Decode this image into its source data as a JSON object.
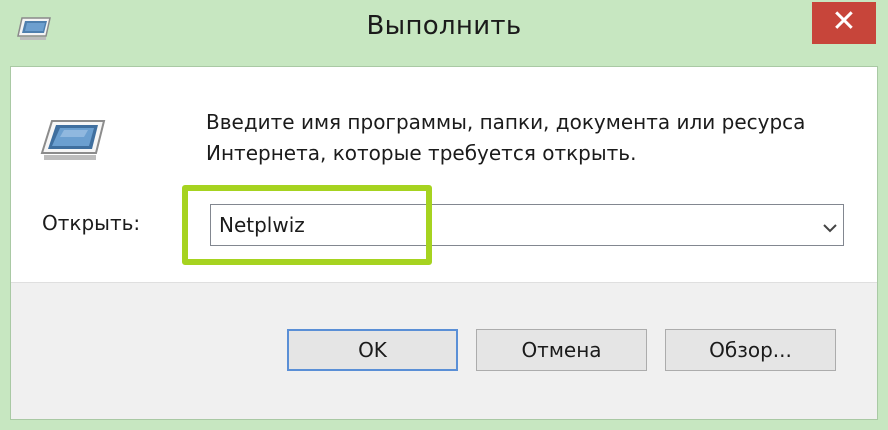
{
  "window": {
    "title": "Выполнить",
    "close_label": "✕",
    "accent_color": "#c7e7c1",
    "close_color": "#c7453a"
  },
  "dialog": {
    "description_line1": "Введите имя программы, папки, документа или ресурса",
    "description_line2": "Интернета, которые требуется открыть.",
    "open_label": "Открыть:",
    "open_value": "Netplwiz",
    "highlight_color": "#a6d320"
  },
  "buttons": {
    "ok": "OK",
    "cancel": "Отмена",
    "browse": "Обзор..."
  },
  "icons": {
    "title": "run-icon",
    "main": "run-icon",
    "dropdown": "chevron-down-icon",
    "close": "close-icon"
  }
}
